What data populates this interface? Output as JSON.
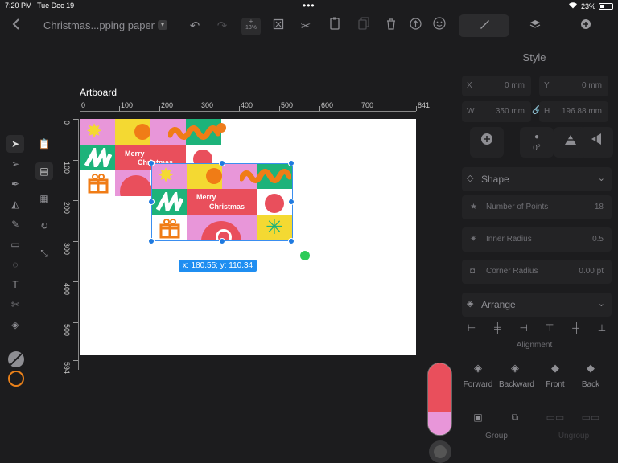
{
  "status": {
    "time": "7:20 PM",
    "date": "Tue Dec 19",
    "battery": "23%"
  },
  "toolbar": {
    "doc_title": "Christmas...pping paper",
    "zoom": "13%",
    "icons": [
      "back-icon",
      "undo-icon",
      "redo-icon",
      "crop-icon",
      "scissors-icon",
      "paste-icon",
      "copy-icon",
      "trash-icon",
      "upload-icon",
      "emoji-icon"
    ]
  },
  "canvas": {
    "artboard_label": "Artboard",
    "ruler_h_ticks": [
      "0",
      "100",
      "200",
      "300",
      "400",
      "500",
      "600",
      "700",
      "841"
    ],
    "ruler_v_ticks": [
      "0",
      "100",
      "200",
      "300",
      "400",
      "500",
      "594"
    ],
    "coord_tooltip": "x: 180.55; y: 110.34",
    "pattern_text_line1": "Merry",
    "pattern_text_line2": "Christmas"
  },
  "panel": {
    "title": "Style",
    "x_label": "X",
    "x_value": "0 mm",
    "y_label": "Y",
    "y_value": "0 mm",
    "w_label": "W",
    "w_value": "350 mm",
    "h_label": "H",
    "h_value": "196.88 mm",
    "rotation": "0°",
    "shape_section": "Shape",
    "points_label": "Number of Points",
    "points_value": "18",
    "inner_radius_label": "Inner Radius",
    "inner_radius_value": "0.5",
    "corner_radius_label": "Corner Radius",
    "corner_radius_value": "0.00 pt",
    "arrange_section": "Arrange",
    "alignment_label": "Alignment",
    "forward_label": "Forward",
    "backward_label": "Backward",
    "front_label": "Front",
    "back_label": "Back",
    "group_label": "Group",
    "ungroup_label": "Ungroup"
  },
  "colors": {
    "accent": "#1f7ae0",
    "pink": "#e896d9",
    "green": "#1db37a",
    "red": "#e94f5c",
    "orange": "#f07c16",
    "yellow": "#f4d932"
  }
}
